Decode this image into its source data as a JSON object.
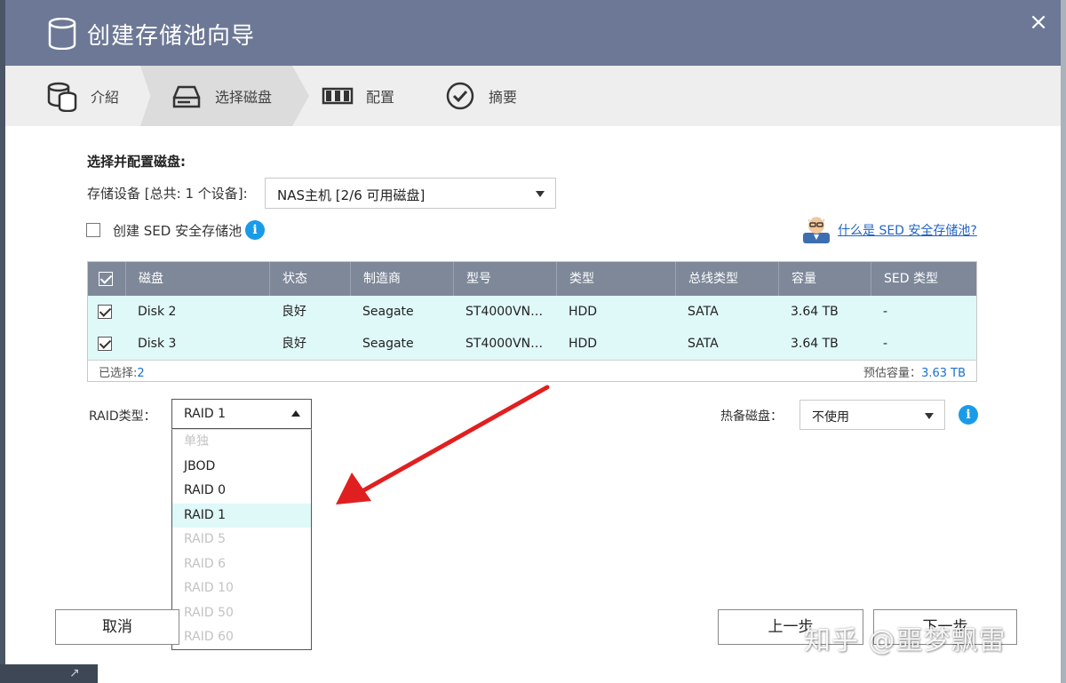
{
  "dialog": {
    "title": "创建存储池向导",
    "close": "×"
  },
  "steps": [
    {
      "label": "介紹",
      "icon": "database-icon"
    },
    {
      "label": "选择磁盘",
      "icon": "disk-drive-icon",
      "active": true
    },
    {
      "label": "配置",
      "icon": "raid-config-icon"
    },
    {
      "label": "摘要",
      "icon": "check-circle-icon"
    }
  ],
  "form": {
    "section_title": "选择并配置磁盘:",
    "device_label": "存储设备 [总共: 1 个设备]:",
    "device_value": "NAS主机 [2/6 可用磁盘]",
    "sed_checkbox_label": "创建 SED 安全存储池",
    "sed_help_link": "什么是 SED 安全存储池?"
  },
  "table": {
    "headers": [
      "磁盘",
      "状态",
      "制造商",
      "型号",
      "类型",
      "总线类型",
      "容量",
      "SED 类型"
    ],
    "rows": [
      {
        "disk": "Disk 2",
        "status": "良好",
        "maker": "Seagate",
        "model": "ST4000VN…",
        "type": "HDD",
        "bus": "SATA",
        "capacity": "3.64 TB",
        "sed": "-",
        "checked": true
      },
      {
        "disk": "Disk 3",
        "status": "良好",
        "maker": "Seagate",
        "model": "ST4000VN…",
        "type": "HDD",
        "bus": "SATA",
        "capacity": "3.64 TB",
        "sed": "-",
        "checked": true
      }
    ],
    "selected_label": "已选择:",
    "selected_count": "2",
    "capacity_label": "预估容量：",
    "capacity_value": "3.63 TB"
  },
  "raid": {
    "label": "RAID类型：",
    "value": "RAID 1",
    "options": [
      {
        "label": "单独",
        "disabled": true
      },
      {
        "label": "JBOD",
        "disabled": false
      },
      {
        "label": "RAID 0",
        "disabled": false
      },
      {
        "label": "RAID 1",
        "disabled": false,
        "selected": true
      },
      {
        "label": "RAID 5",
        "disabled": true
      },
      {
        "label": "RAID 6",
        "disabled": true
      },
      {
        "label": "RAID 10",
        "disabled": true
      },
      {
        "label": "RAID 50",
        "disabled": true
      },
      {
        "label": "RAID 60",
        "disabled": true
      }
    ]
  },
  "hot_spare": {
    "label": "热备磁盘：",
    "value": "不使用"
  },
  "buttons": {
    "cancel": "取消",
    "prev": "上一步",
    "next": "下一步"
  },
  "watermark": "知乎 @噩梦飘雷",
  "colors": {
    "titlebar": "#6c7895",
    "table_header": "#7e8899",
    "row_highlight": "#dff8f8",
    "link": "#2164c4",
    "info": "#1a9be8",
    "annotation_arrow": "#e02020"
  }
}
